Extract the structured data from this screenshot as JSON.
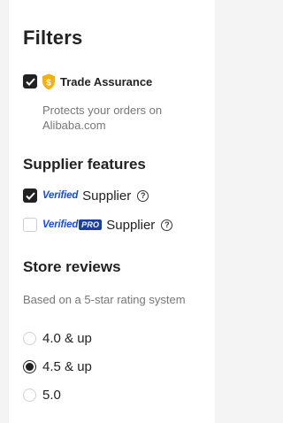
{
  "filters": {
    "title": "Filters",
    "trade_assurance": {
      "label": "Trade Assurance",
      "checked": true,
      "icon": "shield-dollar-icon",
      "description": "Protects your orders on Alibaba.com"
    }
  },
  "supplier_features": {
    "title": "Supplier features",
    "items": [
      {
        "badge": "Verified",
        "label": "Supplier",
        "checked": true
      },
      {
        "badge": "Verified",
        "badge_pro": "PRO",
        "label": "Supplier",
        "checked": false
      }
    ]
  },
  "store_reviews": {
    "title": "Store reviews",
    "note": "Based on a 5-star rating system",
    "options": [
      {
        "label": "4.0 & up",
        "selected": false
      },
      {
        "label": "4.5 & up",
        "selected": true
      },
      {
        "label": "5.0",
        "selected": false
      }
    ]
  },
  "colors": {
    "accent_dark": "#222222",
    "verified_blue": "#1a4fc7",
    "shield_gold": "#f3b20a"
  }
}
